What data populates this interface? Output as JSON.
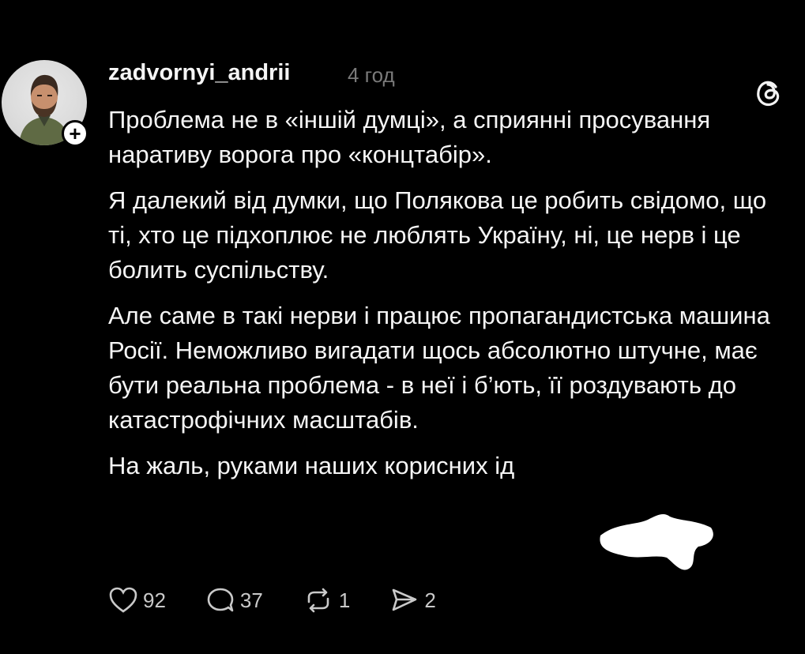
{
  "post": {
    "username": "zadvornyi_andrii",
    "time": "4 год",
    "follow_symbol": "+",
    "paragraphs": [
      "Проблема не в «іншій думці», а сприянні просування наративу ворога про «концтабір».",
      "Я далекий від думки, що Полякова це робить свідомо, що ті, хто це підхоплює не люблять Україну, ні, це нерв і це болить суспільству.",
      "Але саме в такі нерви і працює пропагандистська машина Росії. Неможливо вигадати щось абсолютно штучне, має бути реальна проблема - в неї і б’ють, її роздувають до катастрофічних масштабів.",
      "На жаль, руками наших корисних ід"
    ]
  },
  "actions": {
    "likes": "92",
    "comments": "37",
    "reposts": "1",
    "shares": "2"
  },
  "icons": {
    "like": "heart-icon",
    "comment": "comment-bubble-icon",
    "repost": "repost-icon",
    "share": "send-icon",
    "app": "threads-logo-icon"
  }
}
